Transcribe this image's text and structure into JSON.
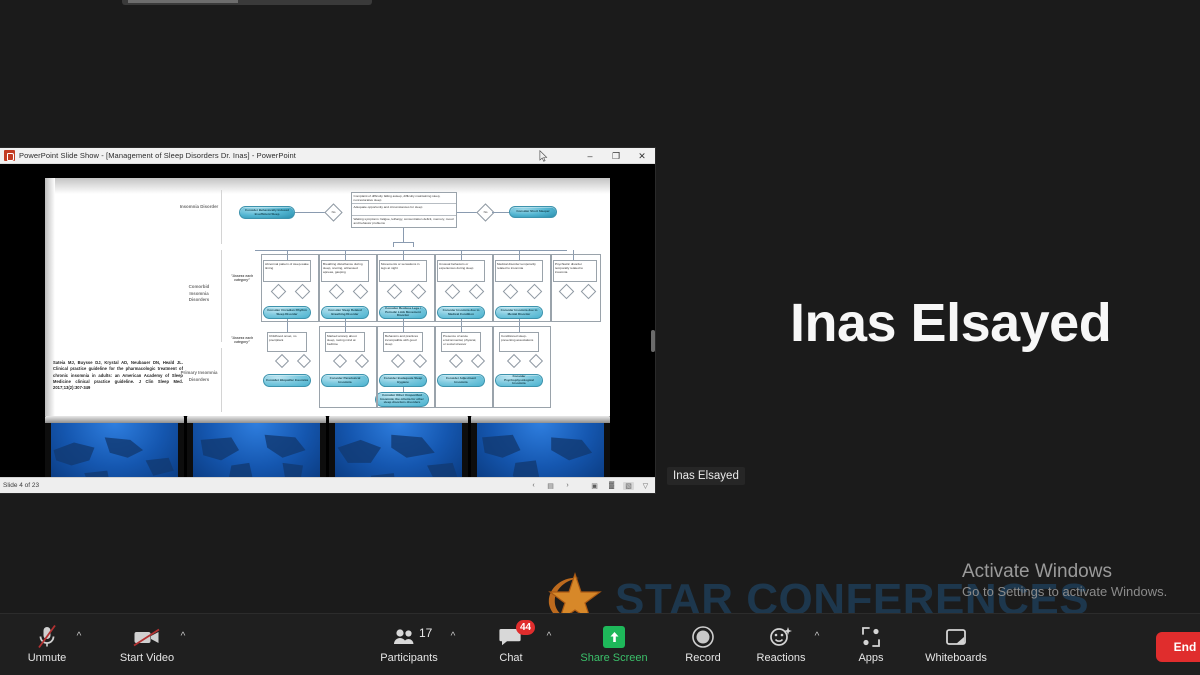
{
  "meeting": {
    "active_speaker_name": "Inas Elsayed",
    "name_tag": "Inas Elsayed"
  },
  "shared_window": {
    "title": "PowerPoint Slide Show  -  [Management of Sleep Disorders Dr. Inas] - PowerPoint",
    "window_controls": {
      "minimize": "–",
      "restore": "❐",
      "close": "✕"
    },
    "status": {
      "slide_indicator": "Slide 4 of 23",
      "prev_label": "‹",
      "next_label": "›",
      "notes_label": "▤",
      "view_normal": "▣",
      "view_sorter": "▓",
      "view_reading": "▧",
      "view_slideshow": "▽"
    }
  },
  "slide": {
    "citation": "Sateia MJ, Buysse DJ, Krystal AD, Neubauer DN, Heald JL. Clinical practice guideline for the pharmacologic treatment of chronic insomnia in adults: an American Academy of Sleep Medicine clinical practice guideline. J Clin Sleep Med. 2017;13(2):307-349",
    "row_labels": [
      "Insomnia Disorder",
      "Comorbid Insomnia Disorders",
      "Primary Insomnia Disorders"
    ],
    "row1": {
      "start_pill": "Consider Behaviorally Induced Insufficient Sleep",
      "criteria_box_lines": [
        "Complaint of difficulty falling asleep, difficulty maintaining sleep, nonrestorative sleep",
        "Adequate opportunity and circumstances for sleep",
        "Waking symptoms: fatigue, lethargy, concentration deficit, memory, mood and behavior problems"
      ],
      "decision": "No",
      "end_pill": "Consider Short Sleeper"
    },
    "row2": {
      "note": "\"Assess each category\"",
      "boxes": [
        "Abnormal pattern of sleep-wake timing",
        "Breathing disturbance during sleep, snoring, witnessed apneas, gasping",
        "Movements or sensations in legs at night",
        "Unusual behaviors or experiences during sleep",
        "Medical disorder temporarily related to insomnia",
        "Psychiatric disorder temporally related to insomnia"
      ],
      "decisions": [
        "Yes",
        "No",
        "Yes",
        "No",
        "Yes",
        "No",
        "Yes",
        "No"
      ],
      "pills": [
        "Consider Circadian Rhythm Sleep Disorder",
        "Consider Sleep Related Breathing Disorder",
        "Consider Restless Legs / Periodic Limb Movement Disorder",
        "Consider Insomnia due to Medical Condition",
        "Consider Insomnia due to Mental Disorder"
      ]
    },
    "row3": {
      "note": "\"Assess each category\"",
      "boxes": [
        "Childhood onset, no precipitant",
        "Marked anxiety about sleep, racing mind at bedtime",
        "Behaviors and practices incompatible with good sleep",
        "Presence of acute environmental, physical, or social stressor",
        "Conditioned sleep-preventing associations"
      ],
      "pills": [
        "Consider Idiopathic Insomnia",
        "Consider Paradoxical Insomnia",
        "Consider Inadequate Sleep Hygiene",
        "Consider Adjustment Insomnia",
        "Consider Psychophysiological Insomnia"
      ],
      "extra_pill": "Consider Other Unspecified Insomnia; the criteria for other sleep disorders disorders"
    }
  },
  "toolbar": {
    "left": [
      {
        "name": "unmute",
        "label": "Unmute",
        "icon": "microphone-muted-icon",
        "has_caret": true
      },
      {
        "name": "start-video",
        "label": "Start Video",
        "icon": "camera-muted-icon",
        "has_caret": true
      }
    ],
    "center": [
      {
        "name": "participants",
        "label": "Participants",
        "icon": "participants-icon",
        "count": "17",
        "has_caret": true
      },
      {
        "name": "chat",
        "label": "Chat",
        "icon": "chat-bubble-icon",
        "badge": "44",
        "has_caret": true
      },
      {
        "name": "share-screen",
        "label": "Share Screen",
        "icon": "share-screen-icon",
        "green": true
      },
      {
        "name": "record",
        "label": "Record",
        "icon": "record-circle-icon"
      },
      {
        "name": "reactions",
        "label": "Reactions",
        "icon": "smiley-reactions-icon",
        "has_caret": true
      },
      {
        "name": "apps",
        "label": "Apps",
        "icon": "apps-grid-icon"
      },
      {
        "name": "whiteboards",
        "label": "Whiteboards",
        "icon": "whiteboard-icon"
      }
    ],
    "end_button": {
      "label": "End",
      "color": "#e02d2d"
    }
  },
  "watermarks": {
    "brand_text": "STAR CONFERENCES",
    "brand_color": "#1e3a52",
    "star_color": "#e8922b",
    "activate_title": "Activate Windows",
    "activate_subtitle": "Go to Settings to activate Windows."
  }
}
